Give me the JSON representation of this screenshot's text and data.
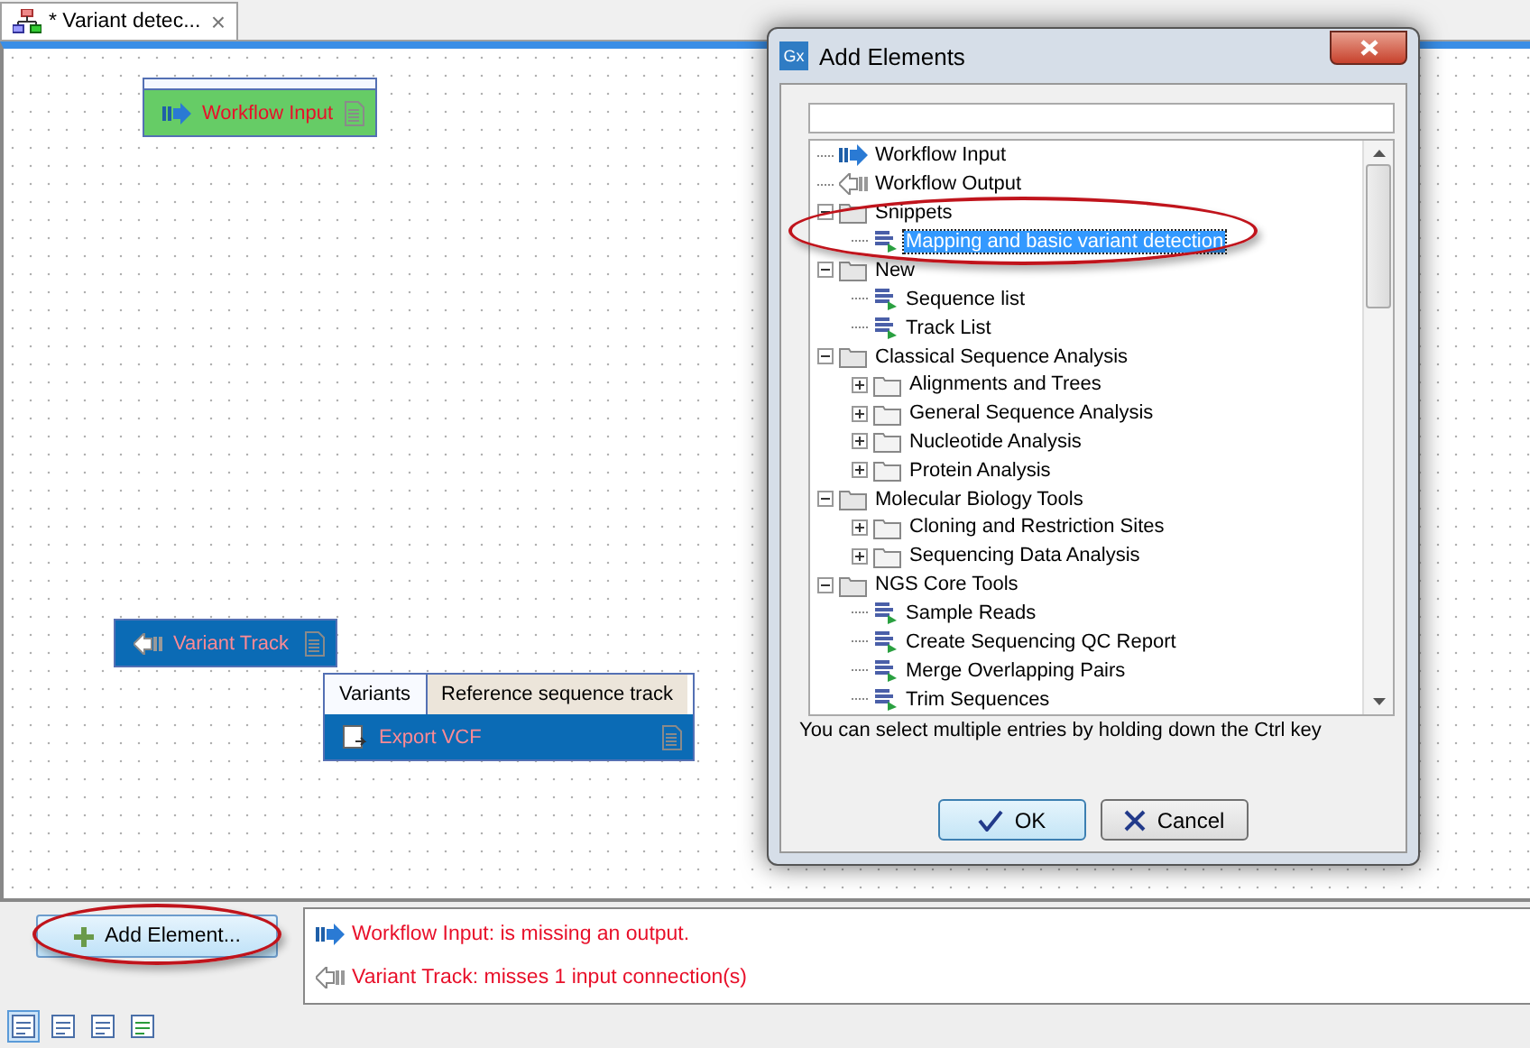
{
  "tab": {
    "title": "* Variant detec...",
    "close": "×"
  },
  "nodes": [
    {
      "kind": "input",
      "label": "Workflow Input"
    },
    {
      "kind": "output",
      "label": "Variant Track"
    },
    {
      "kind": "tool",
      "label": "Export VCF",
      "ports": [
        {
          "label": "Variants",
          "connected": false
        },
        {
          "label": "Reference sequence track",
          "connected": true
        }
      ]
    }
  ],
  "add_button": "Add Element...",
  "messages": [
    {
      "kind": "input",
      "text": "Workflow Input: is missing an output."
    },
    {
      "kind": "output",
      "text": "Variant Track: misses 1 input connection(s)"
    }
  ],
  "view_buttons": [
    {
      "selected": true
    },
    {
      "selected": false
    },
    {
      "selected": false
    },
    {
      "selected": false
    }
  ],
  "dialog": {
    "logo": "Gx",
    "title": "Add Elements",
    "tree": [
      {
        "kind": "input",
        "label": "Workflow Input",
        "selected": false
      },
      {
        "kind": "output",
        "label": "Workflow Output",
        "selected": false
      },
      {
        "kind": "folder",
        "label": "Snippets",
        "expanded": true,
        "selected": false,
        "children": [
          {
            "kind": "item",
            "label": "Mapping and basic variant detection",
            "selected": true
          }
        ]
      },
      {
        "kind": "folder",
        "label": "New",
        "expanded": true,
        "selected": false,
        "children": [
          {
            "kind": "item",
            "label": "Sequence list",
            "selected": false
          },
          {
            "kind": "item",
            "label": "Track List",
            "selected": false
          }
        ]
      },
      {
        "kind": "folder",
        "label": "Classical Sequence Analysis",
        "expanded": true,
        "selected": false,
        "children": [
          {
            "kind": "folder",
            "label": "Alignments and Trees",
            "expanded": false,
            "selected": false
          },
          {
            "kind": "folder",
            "label": "General Sequence Analysis",
            "expanded": false,
            "selected": false
          },
          {
            "kind": "folder",
            "label": "Nucleotide Analysis",
            "expanded": false,
            "selected": false
          },
          {
            "kind": "folder",
            "label": "Protein Analysis",
            "expanded": false,
            "selected": false
          }
        ]
      },
      {
        "kind": "folder",
        "label": "Molecular Biology Tools",
        "expanded": true,
        "selected": false,
        "children": [
          {
            "kind": "folder",
            "label": "Cloning and Restriction Sites",
            "expanded": false,
            "selected": false
          },
          {
            "kind": "folder",
            "label": "Sequencing Data Analysis",
            "expanded": false,
            "selected": false
          }
        ]
      },
      {
        "kind": "folder",
        "label": "NGS Core Tools",
        "expanded": true,
        "selected": false,
        "children": [
          {
            "kind": "item",
            "label": "Sample Reads",
            "selected": false
          },
          {
            "kind": "item",
            "label": "Create Sequencing QC Report",
            "selected": false
          },
          {
            "kind": "item",
            "label": "Merge Overlapping Pairs",
            "selected": false
          },
          {
            "kind": "item",
            "label": "Trim Sequences",
            "selected": false
          }
        ]
      }
    ],
    "hint": "You can select multiple entries by holding down the Ctrl key",
    "buttons": [
      {
        "kind": "ok",
        "label": "OK"
      },
      {
        "kind": "cancel",
        "label": "Cancel"
      }
    ]
  }
}
